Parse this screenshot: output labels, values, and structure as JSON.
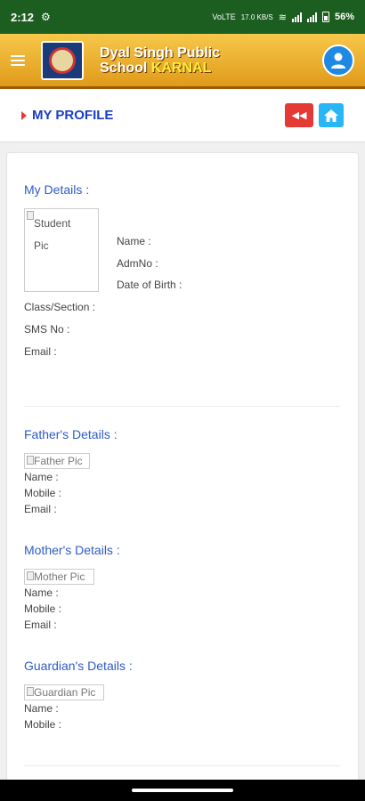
{
  "status": {
    "time": "2:12",
    "net1": "VoLTE",
    "speed": "17.0 KB/S",
    "battery": "56%"
  },
  "header": {
    "school_line1": "Dyal Singh Public",
    "school_line2": "School",
    "school_city": "KARNAL"
  },
  "page": {
    "title": "MY PROFILE"
  },
  "my_details": {
    "title": "My Details :",
    "pic_alt": [
      "Student",
      "Pic"
    ],
    "name": "Name :",
    "admno": "AdmNo :",
    "dob": "Date of Birth :",
    "class": "Class/Section :",
    "sms": "SMS No :",
    "email": "Email :"
  },
  "father": {
    "title": "Father's Details :",
    "pic": "Father Pic",
    "name": "Name :",
    "mobile": "Mobile :",
    "email": "Email :"
  },
  "mother": {
    "title": "Mother's Details :",
    "pic": "Mother Pic",
    "name": "Name :",
    "mobile": "Mobile :",
    "email": "Email :"
  },
  "guardian": {
    "title": "Guardian's Details :",
    "pic": "Guardian Pic",
    "name": "Name :",
    "mobile": "Mobile :"
  }
}
